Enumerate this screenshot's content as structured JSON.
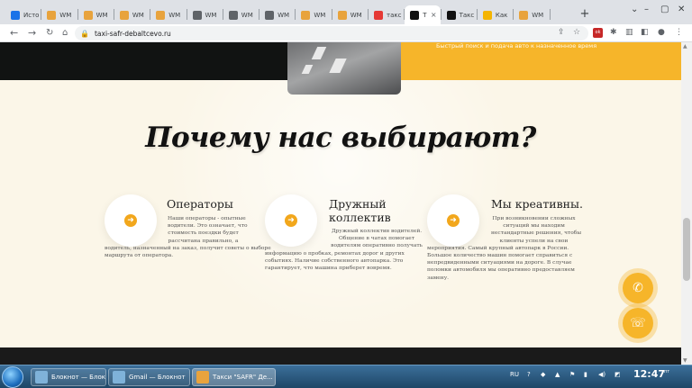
{
  "browser": {
    "tabs": [
      {
        "label": "Исто",
        "icon": "history-icon",
        "color": "#1a73e8"
      },
      {
        "label": "WM",
        "icon": "webmoney-icon",
        "color": "#e8a33d"
      },
      {
        "label": "WM",
        "icon": "webmoney-icon",
        "color": "#e8a33d"
      },
      {
        "label": "WM",
        "icon": "webmoney-icon",
        "color": "#e8a33d"
      },
      {
        "label": "WM",
        "icon": "webmoney-icon",
        "color": "#e8a33d"
      },
      {
        "label": "WM",
        "icon": "globe-icon",
        "color": "#5f6368"
      },
      {
        "label": "WM",
        "icon": "globe-icon",
        "color": "#5f6368"
      },
      {
        "label": "WM",
        "icon": "globe-icon",
        "color": "#5f6368"
      },
      {
        "label": "WM",
        "icon": "webmoney-icon",
        "color": "#e8a33d"
      },
      {
        "label": "WM",
        "icon": "webmoney-icon",
        "color": "#e8a33d"
      },
      {
        "label": "такс",
        "icon": "yandex-icon",
        "color": "#e53935"
      },
      {
        "label": "Т",
        "icon": "taxi-site-icon",
        "color": "#111111",
        "active": true
      },
      {
        "label": "Такс",
        "icon": "taxi-site-icon",
        "color": "#111111"
      },
      {
        "label": "Как",
        "icon": "bookmark-icon",
        "color": "#f4b400"
      },
      {
        "label": "WM",
        "icon": "webmoney-icon",
        "color": "#e8a33d"
      }
    ],
    "close_glyph": "×",
    "new_tab": "+",
    "url": "taxi-safr-debaltcevo.ru"
  },
  "hero": {
    "tagline": "Быстрый поиск и подача авто к назначенное время"
  },
  "section": {
    "heading": "Почему нас выбирают?"
  },
  "features": [
    {
      "title_lines": [
        "Операторы"
      ],
      "text_lines": [
        "Наши операторы - опытные",
        "водители. Это означает, что",
        "стоимость поездки будет",
        "рассчитана правильно, а",
        "водитель, назначенный на заказ, получит советы о выборе",
        "маршрута от оператора."
      ]
    },
    {
      "title_lines": [
        "Дружный",
        "коллектив"
      ],
      "text_lines": [
        "Дружный коллектив водителей.",
        "Общение в чатах помогает",
        "водителям оперативно получать",
        "информацию о пробках, ремонтах дорог и других",
        "событиях. Наличие собственного автопарка. Это",
        "гарантирует, что машина приберет вовремя."
      ]
    },
    {
      "title_lines": [
        "Мы креативны."
      ],
      "text_lines": [
        "При возникновении сложных",
        "ситуаций мы находим",
        "нестандартные решения, чтобы",
        "клиенты успели на свои",
        "мероприятия. Самый крупный автопарк в России.",
        "Большое количество машин помогает справиться с",
        "непредвиденными ситуациями на дороге. В случае",
        "поломки автомобиля мы оперативно предоставляем",
        "замену."
      ]
    }
  ],
  "feature_arrow": "➜",
  "fabs": {
    "whatsapp": "✆",
    "phone": "☏"
  },
  "taskbar": {
    "tasks": [
      {
        "label": "Блокнот — Блокн...",
        "color": "#7fb2d9"
      },
      {
        "label": "Gmail — Блокнот",
        "color": "#7fb2d9"
      },
      {
        "label": "Такси \"SAFR\" Де...",
        "color": "#e8a33d",
        "active": true
      }
    ],
    "lang": "RU",
    "time": "12:47",
    "date": "пт"
  }
}
